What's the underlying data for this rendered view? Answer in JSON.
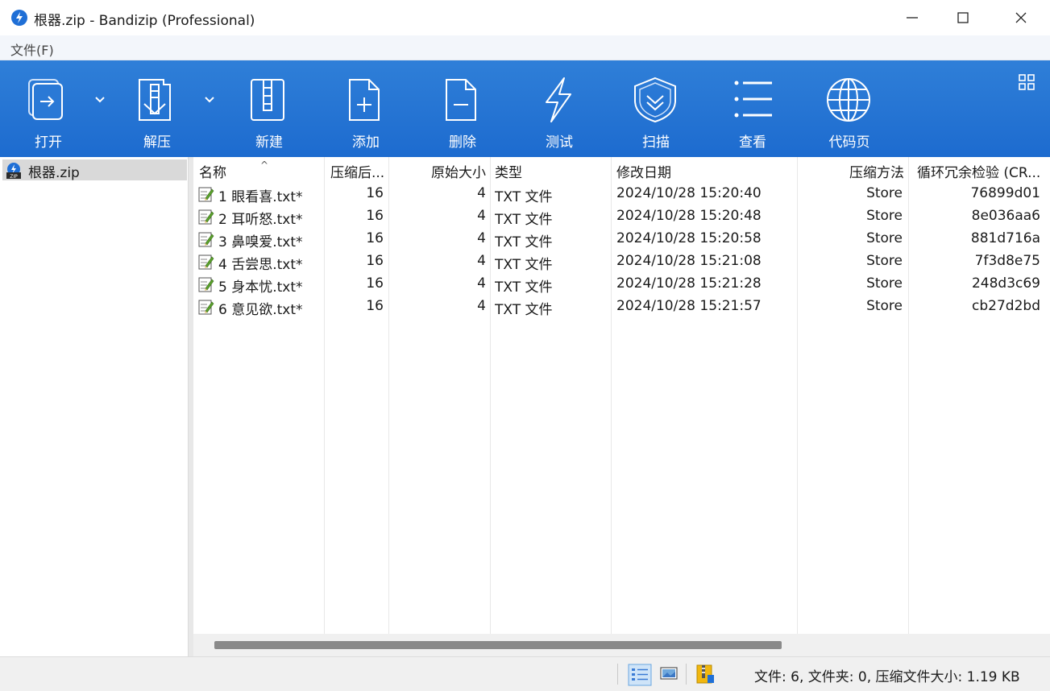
{
  "window": {
    "title": "根器.zip - Bandizip (Professional)",
    "icon": "bandizip-icon"
  },
  "menu": {
    "file": "文件(F)"
  },
  "toolbar": {
    "open": "打开",
    "extract": "解压",
    "new": "新建",
    "add": "添加",
    "delete": "删除",
    "test": "测试",
    "scan": "扫描",
    "view": "查看",
    "codepage": "代码页"
  },
  "tree": {
    "archive": "根器.zip"
  },
  "columns": {
    "name": "名称",
    "packed": "压缩后...",
    "size": "原始大小",
    "type": "类型",
    "modified": "修改日期",
    "method": "压缩方法",
    "crc": "循环冗余检验 (CR..."
  },
  "files": [
    {
      "name": "1 眼看喜.txt*",
      "packed": "16",
      "size": "4",
      "type": "TXT 文件",
      "modified": "2024/10/28 15:20:40",
      "method": "Store",
      "crc": "76899d01"
    },
    {
      "name": "2 耳听怒.txt*",
      "packed": "16",
      "size": "4",
      "type": "TXT 文件",
      "modified": "2024/10/28 15:20:48",
      "method": "Store",
      "crc": "8e036aa6"
    },
    {
      "name": "3 鼻嗅爱.txt*",
      "packed": "16",
      "size": "4",
      "type": "TXT 文件",
      "modified": "2024/10/28 15:20:58",
      "method": "Store",
      "crc": "881d716a"
    },
    {
      "name": "4 舌尝思.txt*",
      "packed": "16",
      "size": "4",
      "type": "TXT 文件",
      "modified": "2024/10/28 15:21:08",
      "method": "Store",
      "crc": "7f3d8e75"
    },
    {
      "name": "5 身本忧.txt*",
      "packed": "16",
      "size": "4",
      "type": "TXT 文件",
      "modified": "2024/10/28 15:21:28",
      "method": "Store",
      "crc": "248d3c69"
    },
    {
      "name": "6 意见欲.txt*",
      "packed": "16",
      "size": "4",
      "type": "TXT 文件",
      "modified": "2024/10/28 15:21:57",
      "method": "Store",
      "crc": "cb27d2bd"
    }
  ],
  "status": {
    "summary": "文件: 6, 文件夹: 0, 压缩文件大小: 1.19 KB"
  },
  "colors": {
    "toolbar": "#1d6bcf",
    "accent": "#2f7fd8"
  }
}
